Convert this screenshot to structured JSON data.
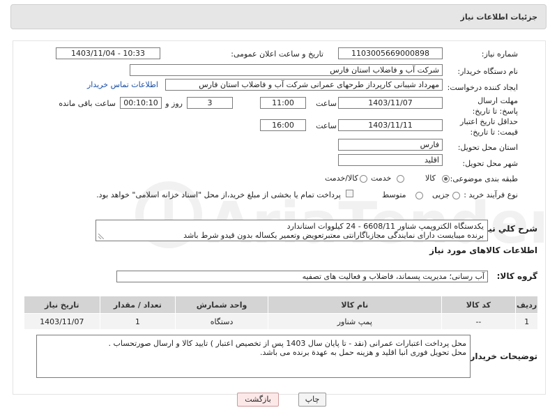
{
  "header": {
    "title": "جزئیات اطلاعات نیاز"
  },
  "labels": {
    "need_number": "شماره نیاز:",
    "announce_datetime": "تاریخ و ساعت اعلان عمومی:",
    "buyer_org": "نام دستگاه خریدار:",
    "requester": "ایجاد کننده درخواست:",
    "contact_link": "اطلاعات تماس خریدار",
    "reply_deadline": "مهلت ارسال پاسخ: تا تاریخ:",
    "time_word": "ساعت",
    "days_word": "روز و",
    "remaining_word": "ساعت باقی مانده",
    "price_validity": "حداقل تاریخ اعتبار قیمت: تا تاریخ:",
    "delivery_province": "استان محل تحویل:",
    "delivery_city": "شهر محل تحویل:",
    "category": "طبقه بندی موضوعی:",
    "process_type": "نوع فرآیند خرید :",
    "need_summary": "شرح كلي نياز:",
    "goods_info": "اطلاعات کالاهای مورد نیاز",
    "goods_group": "گروه کالا:",
    "buyer_notes": "توضیحات خریدار:"
  },
  "values": {
    "need_number": "1103005669000898",
    "announce_datetime": "1403/11/04 - 10:33",
    "buyer_org": "شرکت آب و فاضلاب استان فارس",
    "requester": "مهرداد شیبانی کارپرداز طرحهای عمرانی  شرکت آب و فاضلاب استان فارس",
    "reply_date": "1403/11/07",
    "reply_time": "11:00",
    "reply_days": "3",
    "remaining_time": "00:10:10",
    "price_date": "1403/11/11",
    "price_time": "16:00",
    "delivery_province": "فارس",
    "delivery_city": "اقلید",
    "need_summary_lines": [
      "یکدستگاه الکتروپمپ شناور 6608/11 - 24 کیلووات استاندارد",
      "برنده میبایست دارای نمایندگی مجازباگارانتی معتبرتعویض وتعمیر یکساله بدون قیدو شرط باشد"
    ],
    "goods_group": "آب رسانی؛ مدیریت پسماند، فاضلاب و فعالیت های تصفیه",
    "buyer_notes_lines": [
      "محل پرداخت اعتبارات عمرانی (نقد - تا پایان سال 1403 پس از تخصیص اعتبار ) تایید کالا و ارسال صورتحساب .",
      "محل تحویل فوری انبا اقلید و هزینه حمل به عهدة برنده می باشد."
    ]
  },
  "category_options": [
    {
      "label": "کالا",
      "selected": true
    },
    {
      "label": "خدمت",
      "selected": false
    },
    {
      "label": "کالا/خدمت",
      "selected": false
    }
  ],
  "process_options": [
    {
      "label": "جزیی",
      "selected": false
    },
    {
      "label": "متوسط",
      "selected": false
    }
  ],
  "process_checkbox_label": "پرداخت تمام یا بخشی از مبلغ خرید،از محل \"اسناد خزانه اسلامی\" خواهد بود.",
  "table": {
    "headers": [
      "ردیف",
      "کد کالا",
      "نام کالا",
      "واحد شمارش",
      "تعداد / مقدار",
      "تاریخ نیاز"
    ],
    "rows": [
      [
        "1",
        "--",
        "پمپ شناور",
        "دستگاه",
        "1",
        "1403/11/07"
      ]
    ]
  },
  "buttons": {
    "print": "چاپ",
    "back": "بازگشت"
  },
  "watermark": {
    "text": "AriaTender.neT"
  },
  "colors": {
    "link": "#1a4fa8",
    "back_button_bg": "#fde8e8",
    "print_button_bg": "#f4f4f4"
  }
}
